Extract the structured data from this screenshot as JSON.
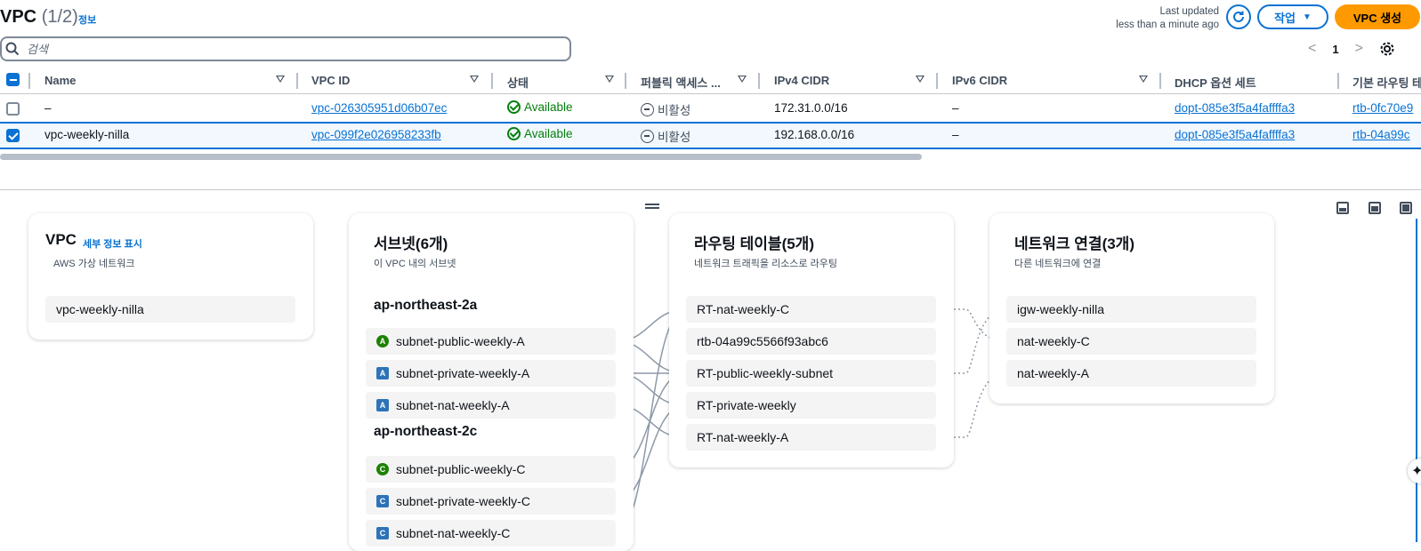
{
  "header": {
    "title": "VPC",
    "count": "(1/2)",
    "info": "정보",
    "last_updated_label": "Last updated",
    "last_updated_value": "less than a minute ago",
    "action_label": "작업",
    "create_label": "VPC 생성"
  },
  "search": {
    "placeholder": "검색"
  },
  "pagination": {
    "page": "1"
  },
  "table": {
    "columns": [
      "Name",
      "VPC ID",
      "상태",
      "퍼블릭 액세스 ...",
      "IPv4 CIDR",
      "IPv6 CIDR",
      "DHCP 옵션 세트",
      "기본 라우팅 테"
    ],
    "rows": [
      {
        "selected": false,
        "name": "–",
        "vpc_id": "vpc-026305951d06b07ec",
        "state": "Available",
        "public_access": "비활성",
        "ipv4": "172.31.0.0/16",
        "ipv6": "–",
        "dhcp": "dopt-085e3f5a4faffffa3",
        "route": "rtb-0fc70e9"
      },
      {
        "selected": true,
        "name": "vpc-weekly-nilla",
        "vpc_id": "vpc-099f2e026958233fb",
        "state": "Available",
        "public_access": "비활성",
        "ipv4": "192.168.0.0/16",
        "ipv6": "–",
        "dhcp": "dopt-085e3f5a4faffffa3",
        "route": "rtb-04a99c"
      }
    ]
  },
  "resource_map": {
    "vpc": {
      "title": "VPC",
      "info": "세부 정보 표시",
      "subtitle": "AWS 가상 네트워크",
      "items": [
        "vpc-weekly-nilla"
      ]
    },
    "subnets": {
      "title": "서브넷(6개)",
      "subtitle": "이 VPC 내의 서브넷",
      "groups": [
        {
          "az": "ap-northeast-2a",
          "items": [
            {
              "badge": "A",
              "type": "public",
              "name": "subnet-public-weekly-A"
            },
            {
              "badge": "A",
              "type": "private",
              "name": "subnet-private-weekly-A"
            },
            {
              "badge": "A",
              "type": "private",
              "name": "subnet-nat-weekly-A"
            }
          ]
        },
        {
          "az": "ap-northeast-2c",
          "items": [
            {
              "badge": "C",
              "type": "public",
              "name": "subnet-public-weekly-C"
            },
            {
              "badge": "C",
              "type": "private",
              "name": "subnet-private-weekly-C"
            },
            {
              "badge": "C",
              "type": "private",
              "name": "subnet-nat-weekly-C"
            }
          ]
        }
      ]
    },
    "route_tables": {
      "title": "라우팅 테이블(5개)",
      "subtitle": "네트워크 트래픽을 리소스로 라우팅",
      "items": [
        "RT-nat-weekly-C",
        "rtb-04a99c5566f93abc6",
        "RT-public-weekly-subnet",
        "RT-private-weekly",
        "RT-nat-weekly-A"
      ]
    },
    "network": {
      "title": "네트워크 연결(3개)",
      "subtitle": "다른 네트워크에 연결",
      "items": [
        "igw-weekly-nilla",
        "nat-weekly-C",
        "nat-weekly-A"
      ]
    }
  },
  "colors": {
    "link": "#0972d3",
    "primary": "#ff9900",
    "available": "#037f0c"
  }
}
